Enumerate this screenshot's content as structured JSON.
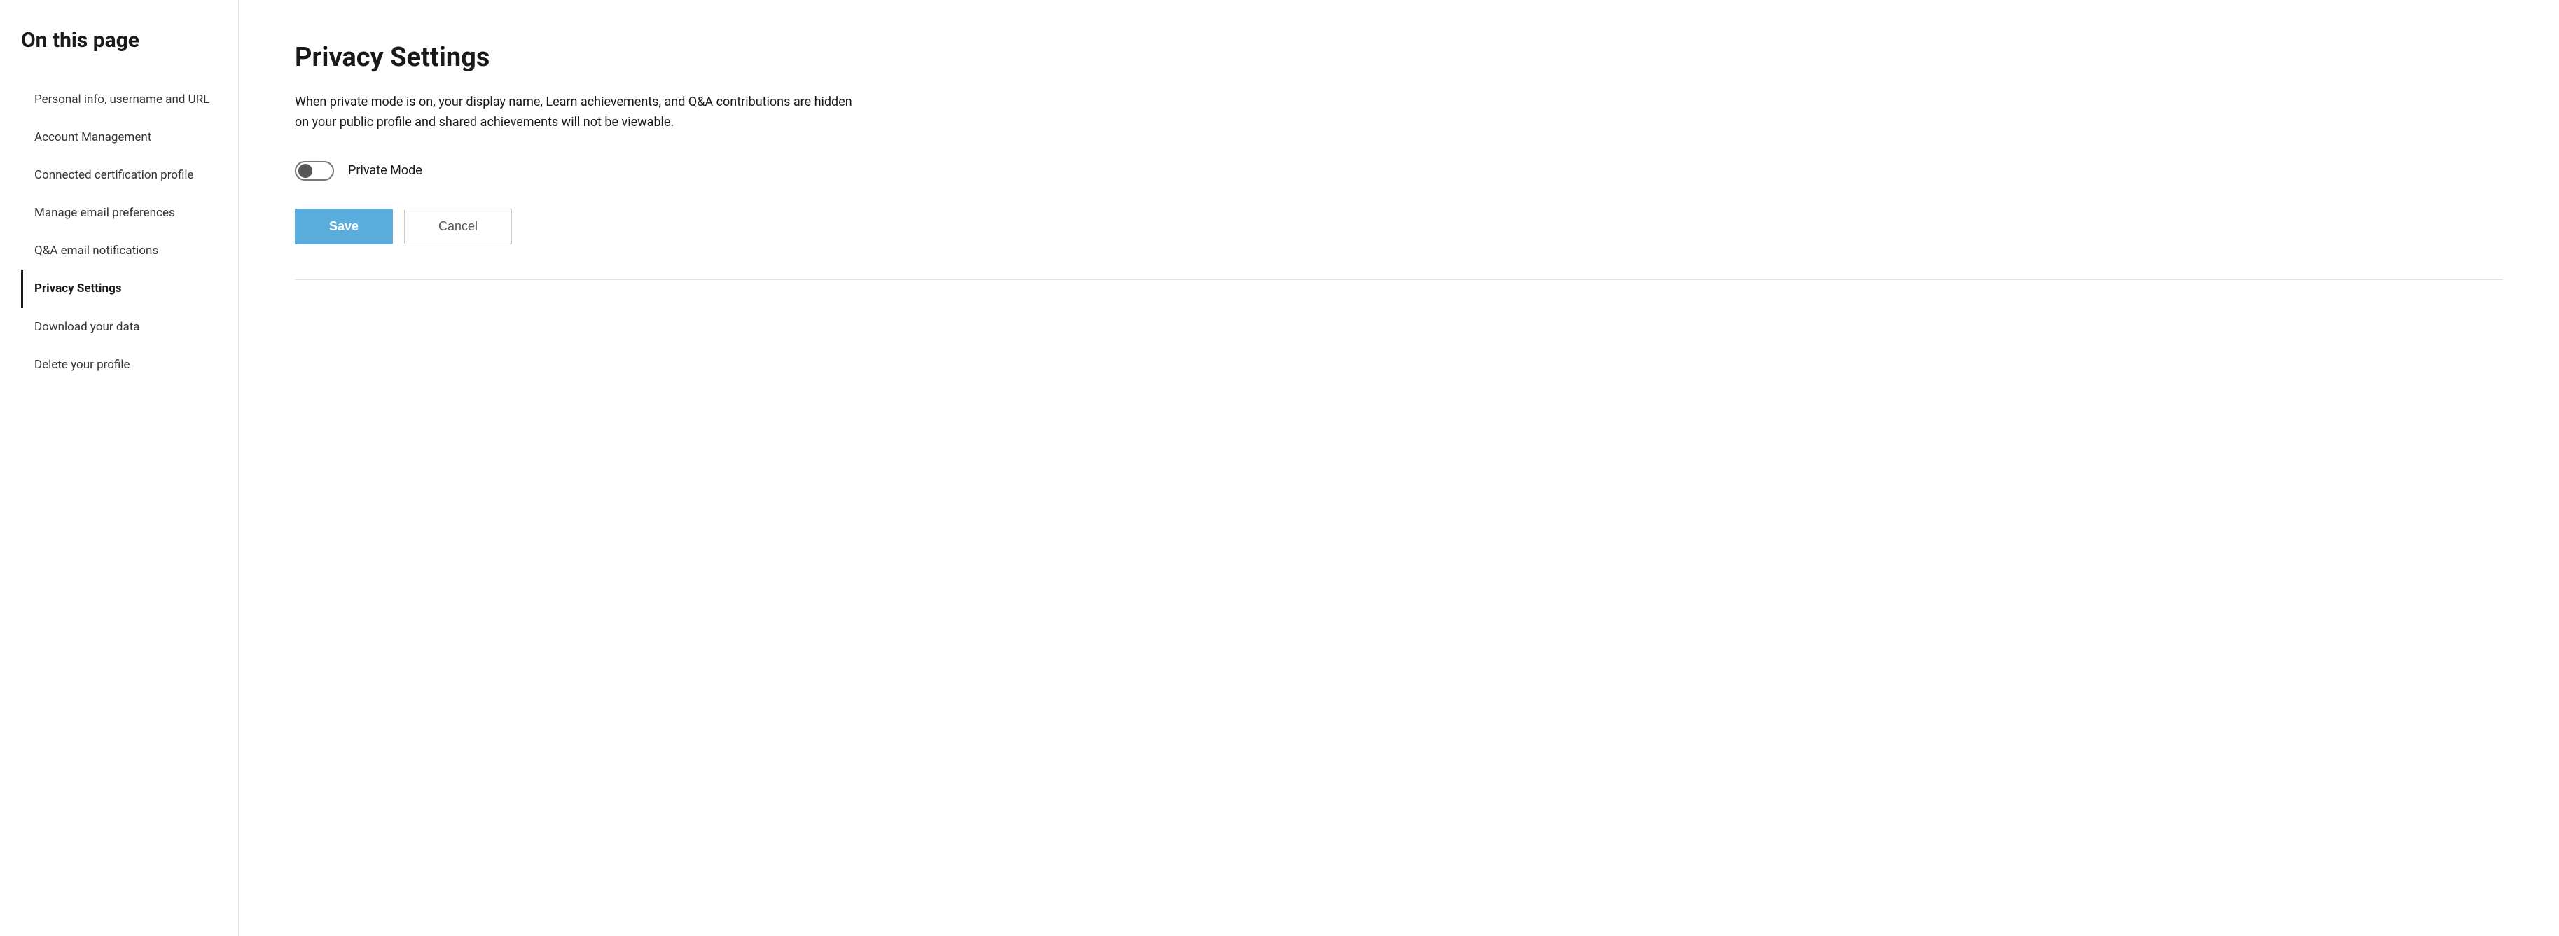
{
  "sidebar": {
    "title": "On this page",
    "items": [
      {
        "id": "personal-info",
        "label": "Personal info, username and URL",
        "active": false
      },
      {
        "id": "account-management",
        "label": "Account Management",
        "active": false
      },
      {
        "id": "connected-certification",
        "label": "Connected certification profile",
        "active": false
      },
      {
        "id": "manage-email",
        "label": "Manage email preferences",
        "active": false
      },
      {
        "id": "qa-email",
        "label": "Q&A email notifications",
        "active": false
      },
      {
        "id": "privacy-settings",
        "label": "Privacy Settings",
        "active": true
      },
      {
        "id": "download-data",
        "label": "Download your data",
        "active": false
      },
      {
        "id": "delete-profile",
        "label": "Delete your profile",
        "active": false
      }
    ]
  },
  "main": {
    "section_title": "Privacy Settings",
    "section_description": "When private mode is on, your display name, Learn achievements, and Q&A contributions are hidden on your public profile and shared achievements will not be viewable.",
    "toggle_label": "Private Mode",
    "toggle_state": false,
    "save_label": "Save",
    "cancel_label": "Cancel"
  }
}
